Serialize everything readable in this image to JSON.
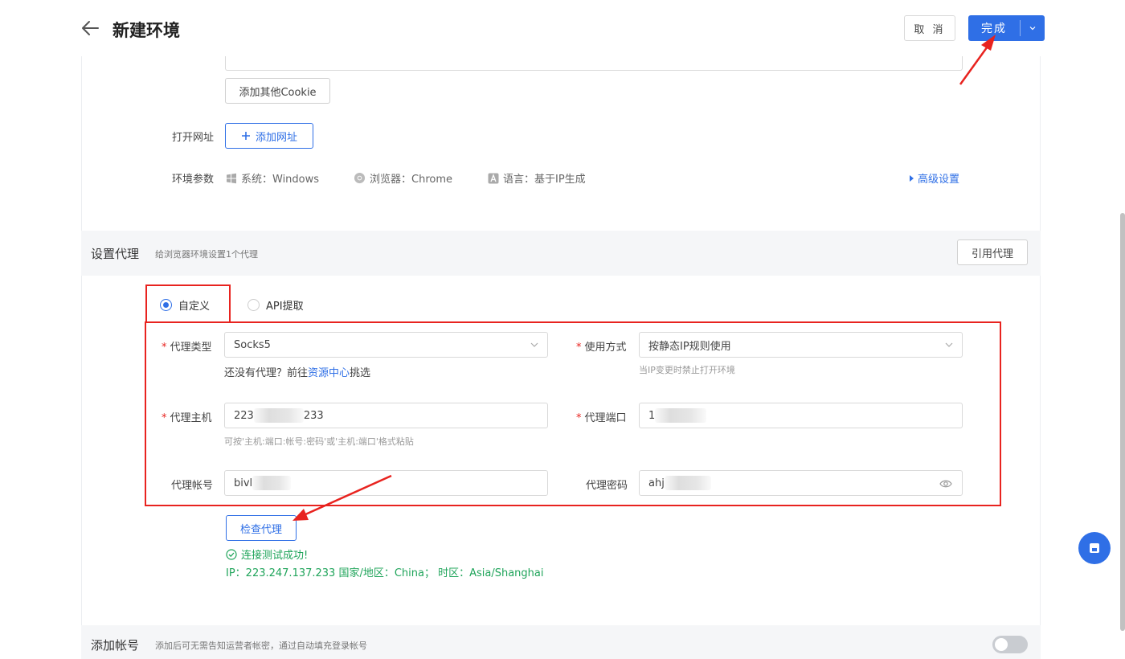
{
  "header": {
    "title": "新建环境",
    "cancel_label": "取 消",
    "done_label": "完成"
  },
  "cookie": {
    "add_cookie_label": "添加其他Cookie"
  },
  "open_url": {
    "label": "打开网址",
    "add_button": "添加网址"
  },
  "env_params": {
    "label": "环境参数",
    "system": "系统：Windows",
    "browser": "浏览器：Chrome",
    "language": "语言：基于IP生成",
    "advanced": "高级设置"
  },
  "proxy_section": {
    "title": "设置代理",
    "subtitle": "给浏览器环境设置1个代理",
    "ref_button": "引用代理",
    "radio_custom": "自定义",
    "radio_api": "API提取",
    "selected": "自定义"
  },
  "proxy_form": {
    "type_label": "代理类型",
    "type_value": "Socks5",
    "no_proxy_prefix": "还没有代理？前往",
    "resource_center": "资源中心",
    "no_proxy_suffix": "挑选",
    "usage_label": "使用方式",
    "usage_value": "按静态IP规则使用",
    "usage_hint": "当IP变更时禁止打开环境",
    "host_label": "代理主机",
    "host_prefix": "223",
    "host_suffix": "233",
    "host_hint": "可按'主机:端口:帐号:密码'或'主机:端口'格式粘贴",
    "port_label": "代理端口",
    "port_value": "1",
    "account_label": "代理帐号",
    "account_value": "bivl",
    "password_label": "代理密码",
    "password_value": "ahj"
  },
  "check": {
    "button": "检查代理",
    "success": "连接测试成功!",
    "ip_info": "IP：223.247.137.233 国家/地区：China； 时区：Asia/Shanghai"
  },
  "account_section": {
    "title": "添加帐号",
    "subtitle": "添加后可无需告知运营者帐密，通过自动填充登录帐号",
    "toggle_on": false
  },
  "colors": {
    "primary": "#2f6fe6",
    "annotation": "#e8231f",
    "success": "#1fa45a"
  }
}
